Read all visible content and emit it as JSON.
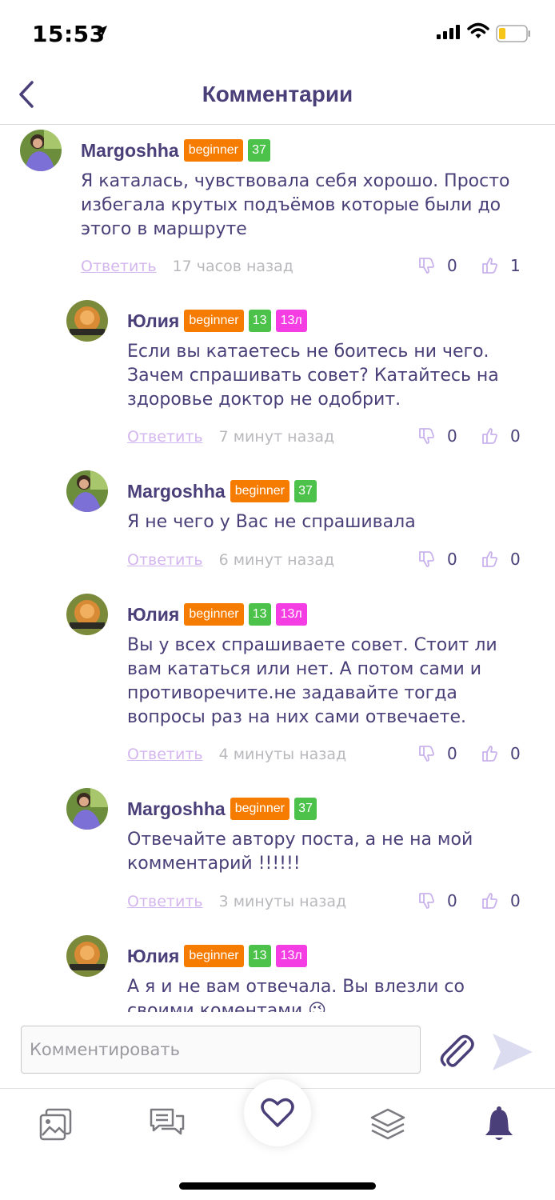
{
  "status_bar": {
    "time": "15:53"
  },
  "header": {
    "title": "Комментарии"
  },
  "comments": [
    {
      "author": "Margoshha",
      "badge_rank": "beginner",
      "badge_level": "37",
      "text_lines": [
        "Я каталась, чувствовала себя хорошо. Просто",
        "избегала крутых подъёмов которые были до",
        "этого в маршруте"
      ],
      "reply_label": "Ответить",
      "time_ago": "17 часов назад",
      "dislikes": "0",
      "likes": "1"
    },
    {
      "author": "Юлия",
      "badge_rank": "beginner",
      "badge_level": "13",
      "badge_age": "13л",
      "text_lines": [
        "Если вы  катаетесь не боитесь ни чего.",
        "Зачем спрашивать совет? Катайтесь на",
        "здоровье доктор не одобрит."
      ],
      "reply_label": "Ответить",
      "time_ago": "7 минут назад",
      "dislikes": "0",
      "likes": "0"
    },
    {
      "author": "Margoshha",
      "badge_rank": "beginner",
      "badge_level": "37",
      "text_lines": [
        "Я не чего у Вас не спрашивала"
      ],
      "reply_label": "Ответить",
      "time_ago": "6 минут назад",
      "dislikes": "0",
      "likes": "0"
    },
    {
      "author": "Юлия",
      "badge_rank": "beginner",
      "badge_level": "13",
      "badge_age": "13л",
      "text_lines": [
        "Вы у всех спрашиваете совет. Стоит ли",
        "вам кататься или нет. А потом сами и",
        "противоречите.не задавайте тогда",
        "вопросы раз на них сами отвечаете."
      ],
      "reply_label": "Ответить",
      "time_ago": "4 минуты назад",
      "dislikes": "0",
      "likes": "0"
    },
    {
      "author": "Margoshha",
      "badge_rank": "beginner",
      "badge_level": "37",
      "text_lines": [
        "Отвечайте автору поста, а не на мой",
        "комментарий !!!!!!"
      ],
      "reply_label": "Ответить",
      "time_ago": "3 минуты назад",
      "dislikes": "0",
      "likes": "0"
    },
    {
      "author": "Юлия",
      "badge_rank": "beginner",
      "badge_level": "13",
      "badge_age": "13л",
      "text_lines": [
        "А я и не вам отвечала. Вы влезли со",
        "своими коментами 😉"
      ]
    }
  ],
  "input": {
    "placeholder": "Комментировать"
  },
  "colors": {
    "primary": "#4a3f78",
    "beginner_badge": "#f57c00",
    "level_badge": "#4cc24a",
    "age_badge": "#f43ee3",
    "reply_link": "#d4b6ee",
    "icon_purple": "#c9b2ec"
  },
  "icons": {
    "back": "chevron-left-icon",
    "attach": "paperclip-icon",
    "send": "send-icon",
    "tabs": [
      "gallery-icon",
      "chat-icon",
      "heart-icon",
      "layers-icon",
      "bell-icon"
    ]
  }
}
